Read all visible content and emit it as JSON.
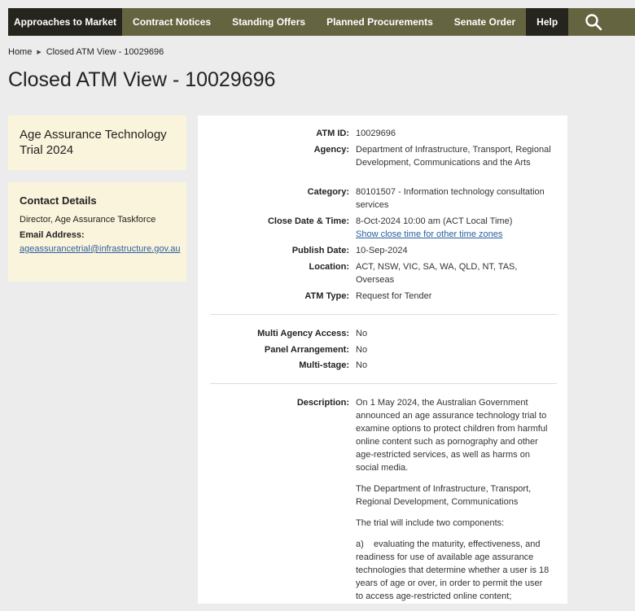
{
  "nav": {
    "items": [
      "Approaches to Market",
      "Contract Notices",
      "Standing Offers",
      "Planned Procurements",
      "Senate Order",
      "Help"
    ],
    "search_icon": "search-icon"
  },
  "breadcrumb": {
    "home": "Home",
    "current": "Closed ATM View - 10029696"
  },
  "page_title": "Closed ATM View - 10029696",
  "sidebar": {
    "title": "Age Assurance Technology Trial 2024",
    "contact": {
      "heading": "Contact Details",
      "role": "Director, Age Assurance Taskforce",
      "email_label": "Email Address:",
      "email": "ageassurancetrial@infrastructure.gov.au"
    }
  },
  "details": {
    "atm_id": {
      "label": "ATM ID:",
      "value": "10029696"
    },
    "agency": {
      "label": "Agency:",
      "value": "Department of Infrastructure, Transport, Regional Development, Communications and the Arts"
    },
    "category": {
      "label": "Category:",
      "value": "80101507 - Information technology consultation services"
    },
    "close_date": {
      "label": "Close Date & Time:",
      "value": "8-Oct-2024 10:00 am (ACT Local Time)",
      "link": "Show close time for other time zones"
    },
    "publish_date": {
      "label": "Publish Date:",
      "value": "10-Sep-2024"
    },
    "location": {
      "label": "Location:",
      "value": "ACT, NSW, VIC, SA, WA, QLD, NT, TAS, Overseas"
    },
    "atm_type": {
      "label": "ATM Type:",
      "value": "Request for Tender"
    },
    "multi_agency": {
      "label": "Multi Agency Access:",
      "value": "No"
    },
    "panel": {
      "label": "Panel Arrangement:",
      "value": "No"
    },
    "multi_stage": {
      "label": "Multi-stage:",
      "value": "No"
    },
    "description": {
      "label": "Description:",
      "paragraphs": [
        "On 1 May 2024, the Australian Government announced an age assurance technology trial to examine options to protect children from harmful online content such as pornography and other age-restricted services, as well as harms on social media.",
        "The Department of Infrastructure, Transport, Regional Development, Communications",
        "The trial will include two components:",
        "a)    evaluating the maturity, effectiveness, and readiness for use of available age assurance technologies that determine whether a user is 18 years of age or over, in order to permit the user to access age-restricted online content;"
      ]
    }
  }
}
